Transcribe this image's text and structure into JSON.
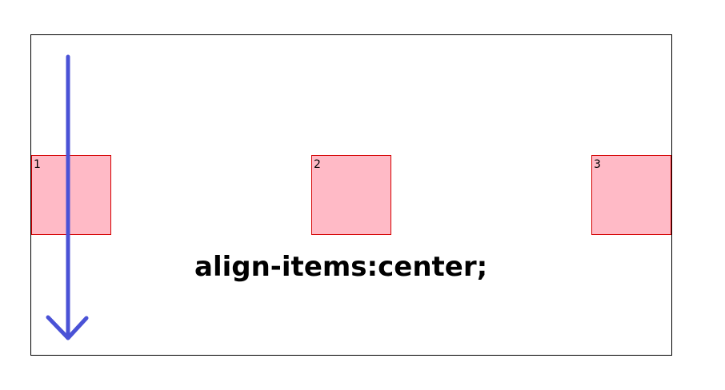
{
  "items": [
    {
      "label": "1"
    },
    {
      "label": "2"
    },
    {
      "label": "3"
    }
  ],
  "caption": "align-items:center;",
  "colors": {
    "item_fill": "#ffbac6",
    "item_border": "#d40000",
    "arrow": "#4a52d6",
    "container_border": "#000000"
  },
  "icons": {
    "arrow": "down-arrow-icon"
  }
}
